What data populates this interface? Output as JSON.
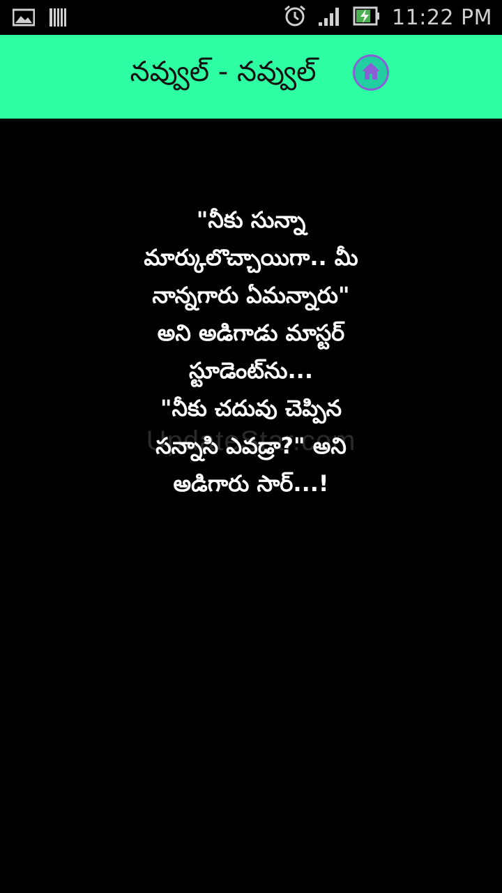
{
  "status_bar": {
    "time": "11:22 PM",
    "icons": [
      "gallery-icon",
      "usb-debug-icon",
      "alarm-icon",
      "signal-icon",
      "battery-charging-icon"
    ]
  },
  "header": {
    "title": "నవ్వుల్ - నవ్వుల్",
    "home_icon": "home-icon",
    "accent_color": "#2effa2",
    "home_icon_color": "#8a5fd6"
  },
  "content": {
    "joke_text": "\"నీకు సున్నా\nమార్కులొచ్చాయిగా.. మీ\nనాన్నగారు ఏమన్నారు\"\nఅని అడిగాడు మాస్టర్\nస్టూడెంట్‌ను...\n\"నీకు చదువు చెప్పిన\nసన్నాసి ఎవడ్రా?\" అని\nఅడిగారు సార్...!",
    "watermark": "UpdateStar.com",
    "text_color": "#ffffff",
    "background_color": "#000000"
  }
}
